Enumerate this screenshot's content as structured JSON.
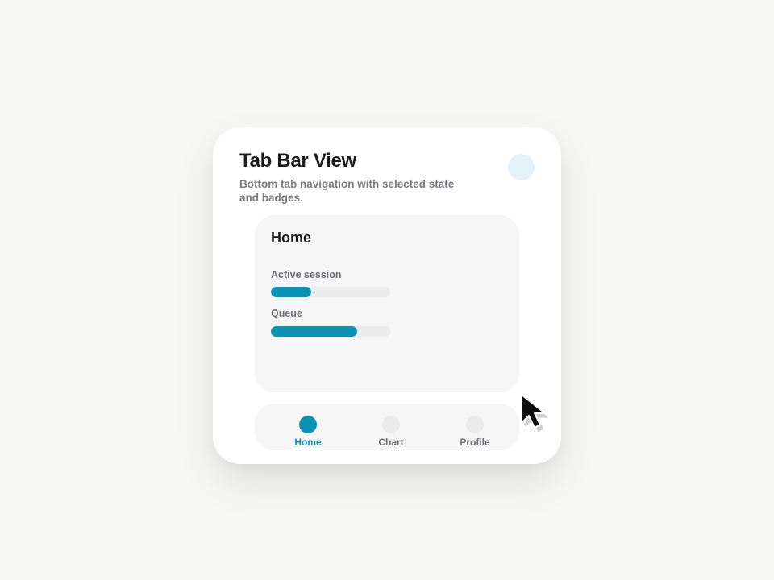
{
  "header": {
    "title": "Tab Bar View",
    "subtitle": "Bottom tab navigation with selected state and badges."
  },
  "panel": {
    "title": "Home",
    "metrics": [
      {
        "label": "Active session",
        "progress": 0.34
      },
      {
        "label": "Queue",
        "progress": 0.72
      }
    ]
  },
  "tabbar": {
    "selected": "Home",
    "tabs": [
      {
        "label": "Home",
        "icon": "home-icon",
        "active": true
      },
      {
        "label": "Chart",
        "icon": "chart-icon",
        "active": false
      },
      {
        "label": "Profile",
        "icon": "profile-icon",
        "active": false
      }
    ]
  },
  "colors": {
    "accent": "#0a93b5",
    "avatar": "#e2f2f8",
    "background": "#f7f7f5"
  },
  "icons": {
    "avatar": "avatar-icon",
    "cursor": "mouse-pointer-icon"
  }
}
